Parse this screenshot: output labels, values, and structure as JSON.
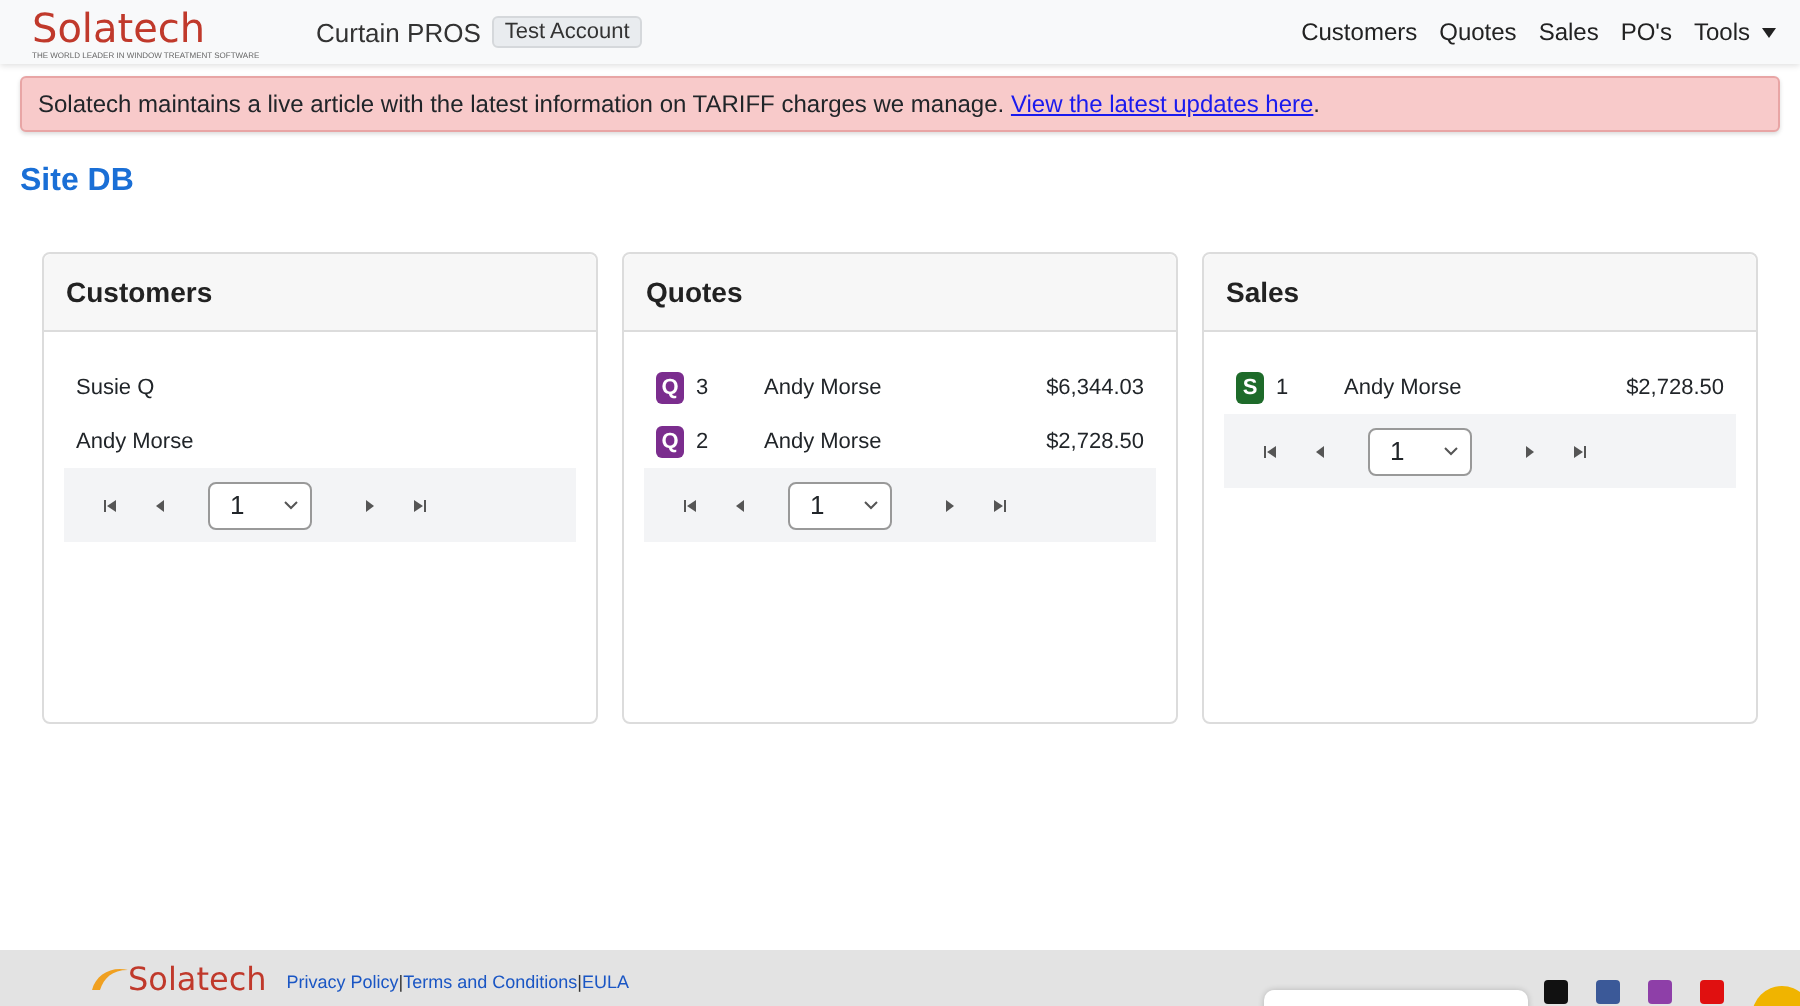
{
  "navbar": {
    "logo": "Solatech",
    "tagline": "THE WORLD LEADER IN WINDOW TREATMENT SOFTWARE",
    "app_name": "Curtain PROS",
    "account_badge": "Test Account",
    "menu": [
      {
        "label": "Customers",
        "dropdown": false
      },
      {
        "label": "Quotes",
        "dropdown": false
      },
      {
        "label": "Sales",
        "dropdown": false
      },
      {
        "label": "PO's",
        "dropdown": false
      },
      {
        "label": "Tools",
        "dropdown": true
      }
    ]
  },
  "alert": {
    "text": "Solatech maintains a live article with the latest information on TARIFF charges we manage.",
    "link": "View the latest updates here",
    "after": "."
  },
  "page_title": "Site DB",
  "cards": [
    {
      "title": "Customers",
      "kind": "customers",
      "rows": [
        {
          "name": "Susie Q"
        },
        {
          "name": "Andy Morse"
        }
      ],
      "pager": {
        "page": "1"
      }
    },
    {
      "title": "Quotes",
      "kind": "records",
      "rows": [
        {
          "badge": "Q",
          "color": "#7b2d8e",
          "number": "3",
          "name": "Andy Morse",
          "amount": "$6,344.03"
        },
        {
          "badge": "Q",
          "color": "#7b2d8e",
          "number": "2",
          "name": "Andy Morse",
          "amount": "$2,728.50"
        }
      ],
      "pager": {
        "page": "1"
      }
    },
    {
      "title": "Sales",
      "kind": "records",
      "rows": [
        {
          "badge": "S",
          "color": "#1e6b2a",
          "number": "1",
          "name": "Andy Morse",
          "amount": "$2,728.50"
        }
      ],
      "pager": {
        "page": "1"
      }
    }
  ],
  "footer": {
    "logo": "Solatech",
    "links": [
      {
        "label": "Privacy Policy"
      },
      {
        "label": "Terms and Conditions"
      },
      {
        "label": "EULA"
      }
    ],
    "separator": "|"
  }
}
